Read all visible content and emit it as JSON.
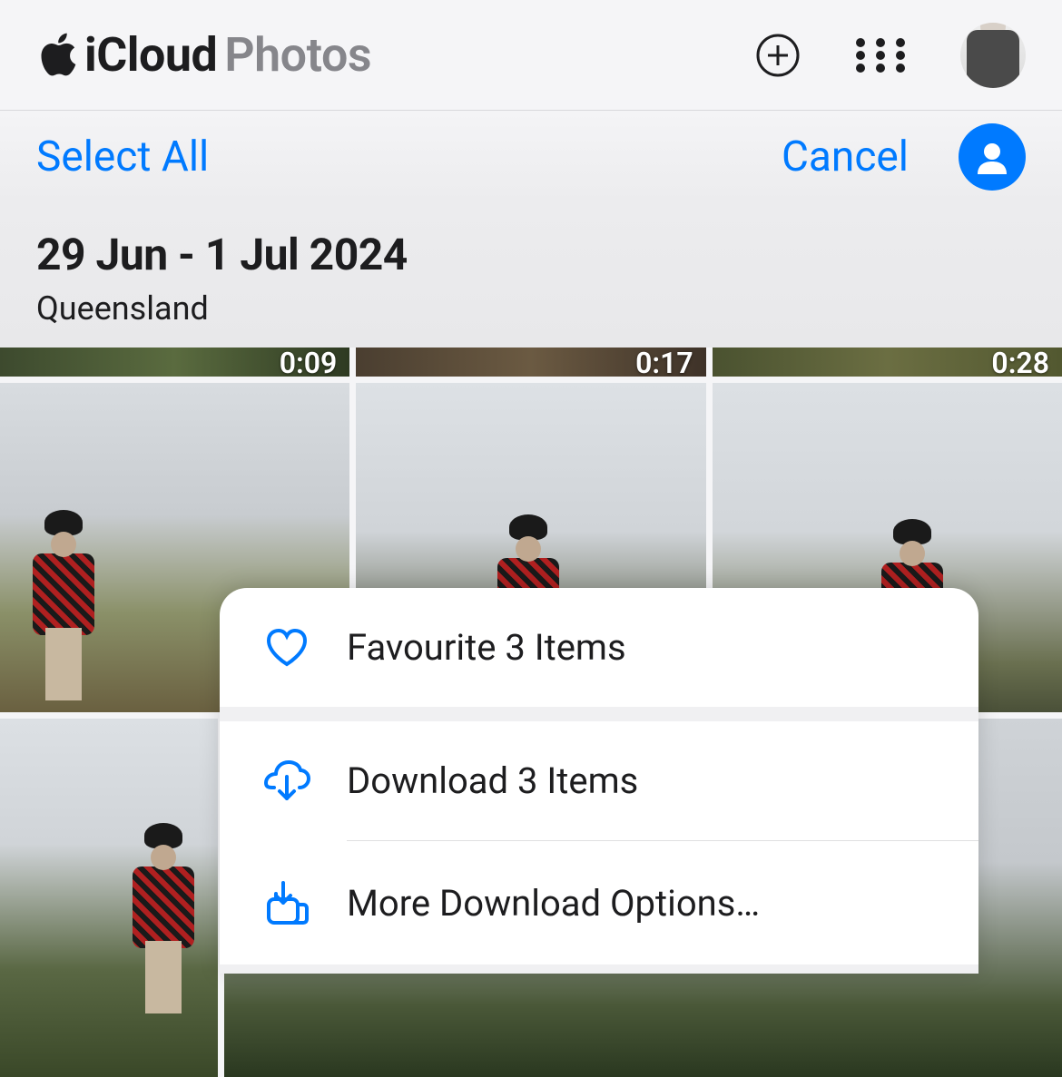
{
  "header": {
    "brand_icloud": "iCloud",
    "brand_photos": "Photos"
  },
  "selection_bar": {
    "select_all_label": "Select All",
    "cancel_label": "Cancel"
  },
  "album": {
    "date_range": "29 Jun - 1 Jul 2024",
    "location": "Queensland"
  },
  "video_durations": {
    "clip1": "0:09",
    "clip2": "0:17",
    "clip3": "0:28"
  },
  "action_sheet": {
    "favourite_label": "Favourite 3 Items",
    "download_label": "Download 3 Items",
    "more_label": "More Download Options…"
  },
  "colors": {
    "accent": "#007aff"
  }
}
